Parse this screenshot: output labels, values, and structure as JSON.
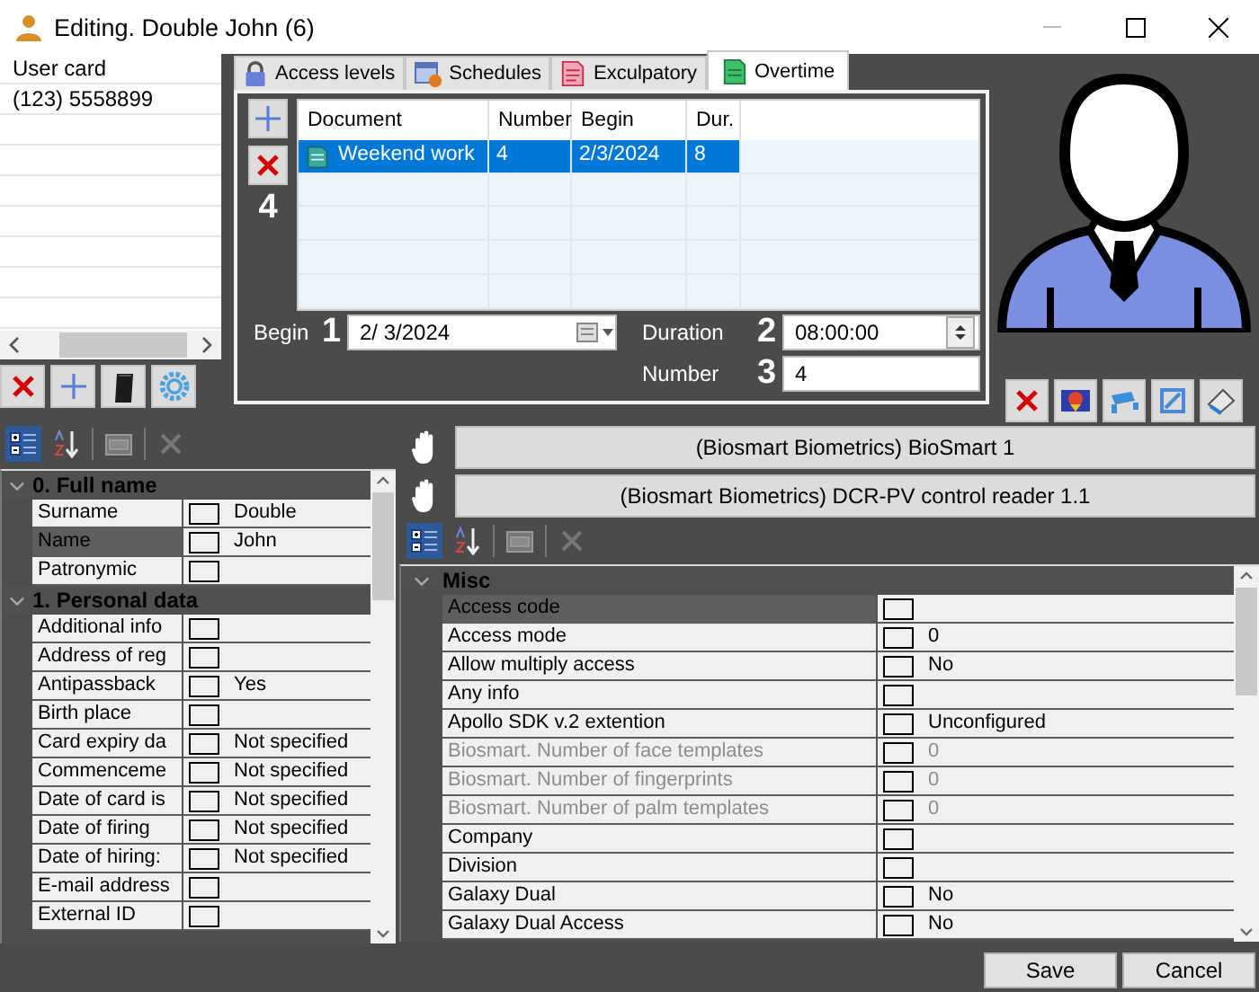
{
  "window": {
    "title": "Editing. Double John (6)"
  },
  "card_list": {
    "items": [
      "User card",
      "(123) 5558899"
    ]
  },
  "tabs": [
    {
      "label": "Access levels",
      "selected": false
    },
    {
      "label": "Schedules",
      "selected": false
    },
    {
      "label": "Exculpatory",
      "selected": false
    },
    {
      "label": "Overtime",
      "selected": true
    }
  ],
  "documents": {
    "columns": [
      "Document",
      "Number",
      "Begin",
      "Dur."
    ],
    "rows": [
      {
        "cells": [
          "Weekend work",
          "4",
          "2/3/2024",
          "8"
        ],
        "selected": true
      }
    ],
    "count_marker": "4"
  },
  "form": {
    "begin": {
      "label": "Begin",
      "marker": "1",
      "value": "2/ 3/2024"
    },
    "duration": {
      "label": "Duration",
      "marker": "2",
      "value": "08:00:00"
    },
    "number": {
      "label": "Number",
      "marker": "3",
      "value": "4"
    }
  },
  "person_grid": {
    "categories": [
      {
        "title": "0. Full name",
        "expanded": true,
        "rows": [
          {
            "label": "Surname",
            "value": "Double",
            "selected": false,
            "disabled": false
          },
          {
            "label": "Name",
            "value": "John",
            "selected": true,
            "disabled": false
          },
          {
            "label": "Patronymic",
            "value": "",
            "selected": false,
            "disabled": false
          }
        ]
      },
      {
        "title": "1. Personal data",
        "expanded": true,
        "rows": [
          {
            "label": "Additional info",
            "value": "",
            "selected": false,
            "disabled": false
          },
          {
            "label": "Address of reg",
            "value": "",
            "selected": false,
            "disabled": false
          },
          {
            "label": "Antipassback",
            "value": "Yes",
            "selected": false,
            "disabled": false
          },
          {
            "label": "Birth place",
            "value": "",
            "selected": false,
            "disabled": false
          },
          {
            "label": "Card expiry da",
            "value": "Not specified",
            "selected": false,
            "disabled": false
          },
          {
            "label": "Commenceme",
            "value": "Not specified",
            "selected": false,
            "disabled": false
          },
          {
            "label": "Date of card is",
            "value": "Not specified",
            "selected": false,
            "disabled": false
          },
          {
            "label": "Date of firing",
            "value": "Not specified",
            "selected": false,
            "disabled": false
          },
          {
            "label": "Date of hiring:",
            "value": "Not specified",
            "selected": false,
            "disabled": false
          },
          {
            "label": "E-mail address",
            "value": "",
            "selected": false,
            "disabled": false
          },
          {
            "label": "External ID",
            "value": "",
            "selected": false,
            "disabled": false
          }
        ]
      }
    ]
  },
  "devices": [
    "(Biosmart Biometrics) BioSmart 1",
    "(Biosmart Biometrics) DCR-PV control reader 1.1"
  ],
  "device_grid": {
    "categories": [
      {
        "title": "Misc",
        "expanded": true,
        "rows": [
          {
            "label": "Access code",
            "value": "",
            "selected": true,
            "disabled": false
          },
          {
            "label": "Access mode",
            "value": "0",
            "selected": false,
            "disabled": false
          },
          {
            "label": "Allow multiply access",
            "value": "No",
            "selected": false,
            "disabled": false
          },
          {
            "label": "Any info",
            "value": "",
            "selected": false,
            "disabled": false
          },
          {
            "label": "Apollo SDK v.2 extention",
            "value": "Unconfigured",
            "selected": false,
            "disabled": false
          },
          {
            "label": "Biosmart. Number of face templates",
            "value": "0",
            "selected": false,
            "disabled": true
          },
          {
            "label": "Biosmart. Number of fingerprints",
            "value": "0",
            "selected": false,
            "disabled": true
          },
          {
            "label": "Biosmart. Number of palm templates",
            "value": "0",
            "selected": false,
            "disabled": true
          },
          {
            "label": "Company",
            "value": "",
            "selected": false,
            "disabled": false
          },
          {
            "label": "Division",
            "value": "",
            "selected": false,
            "disabled": false
          },
          {
            "label": "Galaxy Dual",
            "value": "No",
            "selected": false,
            "disabled": false
          },
          {
            "label": "Galaxy Dual Access",
            "value": "No",
            "selected": false,
            "disabled": false
          }
        ]
      }
    ]
  },
  "buttons": [
    "Save",
    "Cancel"
  ]
}
